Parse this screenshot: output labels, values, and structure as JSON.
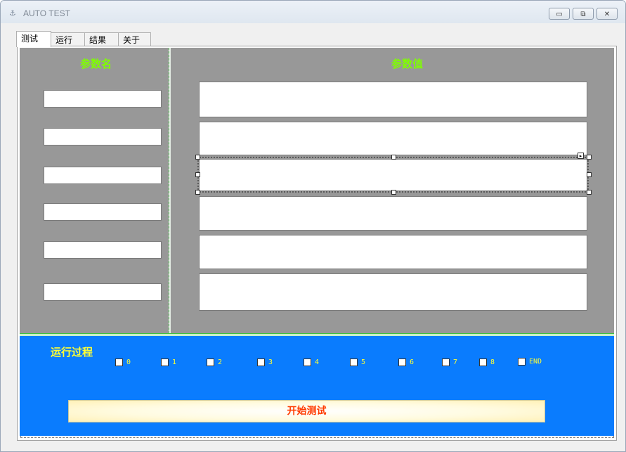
{
  "window": {
    "title": "AUTO TEST"
  },
  "title_buttons": {
    "minimize": "▭",
    "maximize": "⧉",
    "close": "✕"
  },
  "tabs": [
    {
      "label": "测试",
      "active": true
    },
    {
      "label": "运行",
      "active": false
    },
    {
      "label": "结果",
      "active": false
    },
    {
      "label": "关于",
      "active": false
    }
  ],
  "params": {
    "name_header": "参数名",
    "value_header": "参数值",
    "name_fields": [
      "",
      "",
      "",
      "",
      "",
      ""
    ],
    "value_fields": [
      "",
      "",
      "",
      "",
      "",
      ""
    ]
  },
  "process": {
    "label": "运行过程",
    "steps": [
      {
        "label": "0",
        "checked": false
      },
      {
        "label": "1",
        "checked": false
      },
      {
        "label": "2",
        "checked": false
      },
      {
        "label": "3",
        "checked": false
      },
      {
        "label": "4",
        "checked": false
      },
      {
        "label": "5",
        "checked": false
      },
      {
        "label": "6",
        "checked": false
      },
      {
        "label": "7",
        "checked": false
      },
      {
        "label": "8",
        "checked": false
      },
      {
        "label": "END",
        "checked": false
      }
    ]
  },
  "actions": {
    "start_label": "开始测试"
  },
  "colors": {
    "panel_gray": "#989898",
    "header_green": "#7fff00",
    "process_blue": "#0a7cfe",
    "process_yellow": "#ffff33",
    "start_text": "#ff3b00"
  }
}
